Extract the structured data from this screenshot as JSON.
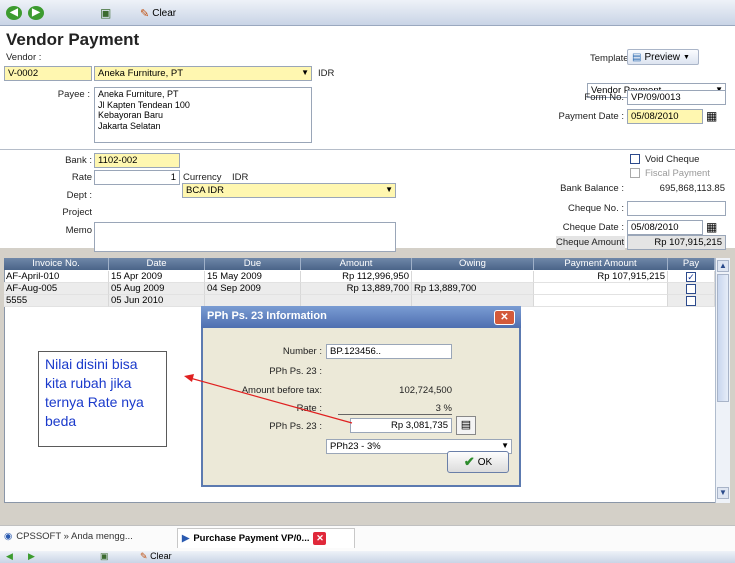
{
  "toolbar": {
    "clear_label": "Clear"
  },
  "header": {
    "title": "Vendor Payment",
    "vendor_label": "Vendor :",
    "vendor_code": "V-0002",
    "vendor_name": "Aneka Furniture, PT",
    "currency": "IDR"
  },
  "template": {
    "label": "Template",
    "preview_label": "Preview",
    "value": "Vendor Payment"
  },
  "payee": {
    "label": "Payee :",
    "lines": [
      "Aneka Furniture, PT",
      "Jl Kapten Tendean 100",
      "Kebayoran Baru",
      "Jakarta Selatan"
    ]
  },
  "form_no": {
    "label": "Form No.",
    "value": "VP/09/0013"
  },
  "payment_date": {
    "label": "Payment Date :",
    "value": "05/08/2010"
  },
  "bank": {
    "label": "Bank :",
    "code": "1102-002",
    "name": "BCA IDR"
  },
  "rate": {
    "label": "Rate",
    "value": "1",
    "currency_label": "Currency",
    "currency": "IDR"
  },
  "dept_label": "Dept :",
  "project_label": "Project",
  "memo_label": "Memo",
  "void_cheque_label": "Void Cheque",
  "fiscal_payment_label": "Fiscal Payment",
  "bank_balance": {
    "label": "Bank Balance :",
    "value": "695,868,113.85"
  },
  "cheque_no_label": "Cheque No. :",
  "cheque_date": {
    "label": "Cheque Date :",
    "value": "05/08/2010"
  },
  "cheque_amount": {
    "label": "Cheque Amount :",
    "value": "Rp 107,915,215"
  },
  "grid": {
    "columns": [
      "Invoice No.",
      "Date",
      "Due",
      "Amount",
      "Owing",
      "Payment Amount",
      "Pay"
    ],
    "rows": [
      {
        "invoice": "AF-April-010",
        "date": "15 Apr 2009",
        "due": "15 May 2009",
        "amount": "Rp 112,996,950",
        "owing": "",
        "payment": "Rp 107,915,215",
        "pay": true
      },
      {
        "invoice": "AF-Aug-005",
        "date": "05 Aug 2009",
        "due": "04 Sep 2009",
        "amount": "Rp 13,889,700",
        "owing": "Rp 13,889,700",
        "payment": "",
        "pay": false
      },
      {
        "invoice": "5555",
        "date": "05 Jun 2010",
        "due": "",
        "amount": "",
        "owing": "",
        "payment": "",
        "pay": false
      }
    ]
  },
  "dialog": {
    "title": "PPh Ps. 23 Information",
    "number_label": "Number :",
    "number_value": "BP.123456..",
    "pph_label": "PPh Ps. 23 :",
    "pph_value": "PPh23 - 3%",
    "amount_before_tax_label": "Amount before tax:",
    "amount_before_tax": "102,724,500",
    "rate_label": "Rate :",
    "rate_value": "3 %",
    "pph_amount_label": "PPh Ps. 23 :",
    "pph_amount": "Rp 3,081,735",
    "ok_label": "OK"
  },
  "callout": {
    "text": "Nilai disini bisa kita rubah jika ternya Rate nya beda"
  },
  "taskbar": {
    "item1": "CPSSOFT » Anda mengg...",
    "item2": "Purchase Payment VP/0..."
  },
  "bottom_toolbar": {
    "clear_label": "Clear"
  }
}
